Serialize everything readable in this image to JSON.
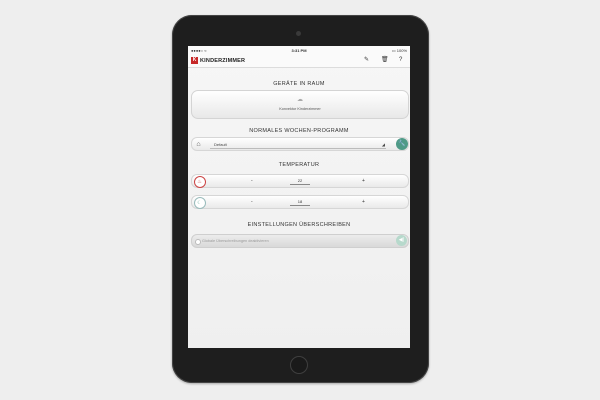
{
  "status_bar": {
    "carrier": "●●●●○ ≈",
    "time": "3:31 PM",
    "battery": "▭ 100%"
  },
  "navbar": {
    "logo_text": "K",
    "title": "KINDERZIMMER",
    "edit_icon": "✎",
    "delete_icon": "🗑",
    "help_icon": "?"
  },
  "devices": {
    "title": "GERÄTE IN RAUM",
    "device_icon": "☁",
    "device_label": "Konvektor Kinderzimmer"
  },
  "program": {
    "title": "NORMALES WOCHEN-PROGRAMM",
    "house_icon": "⌂",
    "selected": "Default",
    "caret": "◢",
    "wrench_icon": "🔧"
  },
  "temperature": {
    "title": "TEMPERATUR",
    "heat": {
      "icon": "♨",
      "minus": "-",
      "value": "22",
      "plus": "+"
    },
    "cool": {
      "icon": "☾",
      "minus": "-",
      "value": "18",
      "plus": "+"
    }
  },
  "override": {
    "title": "EINSTELLUNGEN ÜBERSCHREIBEN",
    "checkbox_label": "Globale Überschreibungen deaktivieren",
    "button_icon": "◀)"
  },
  "colors": {
    "brand": "#c62828",
    "accent": "#4f9a87",
    "accent_light": "#b7d9cc"
  }
}
